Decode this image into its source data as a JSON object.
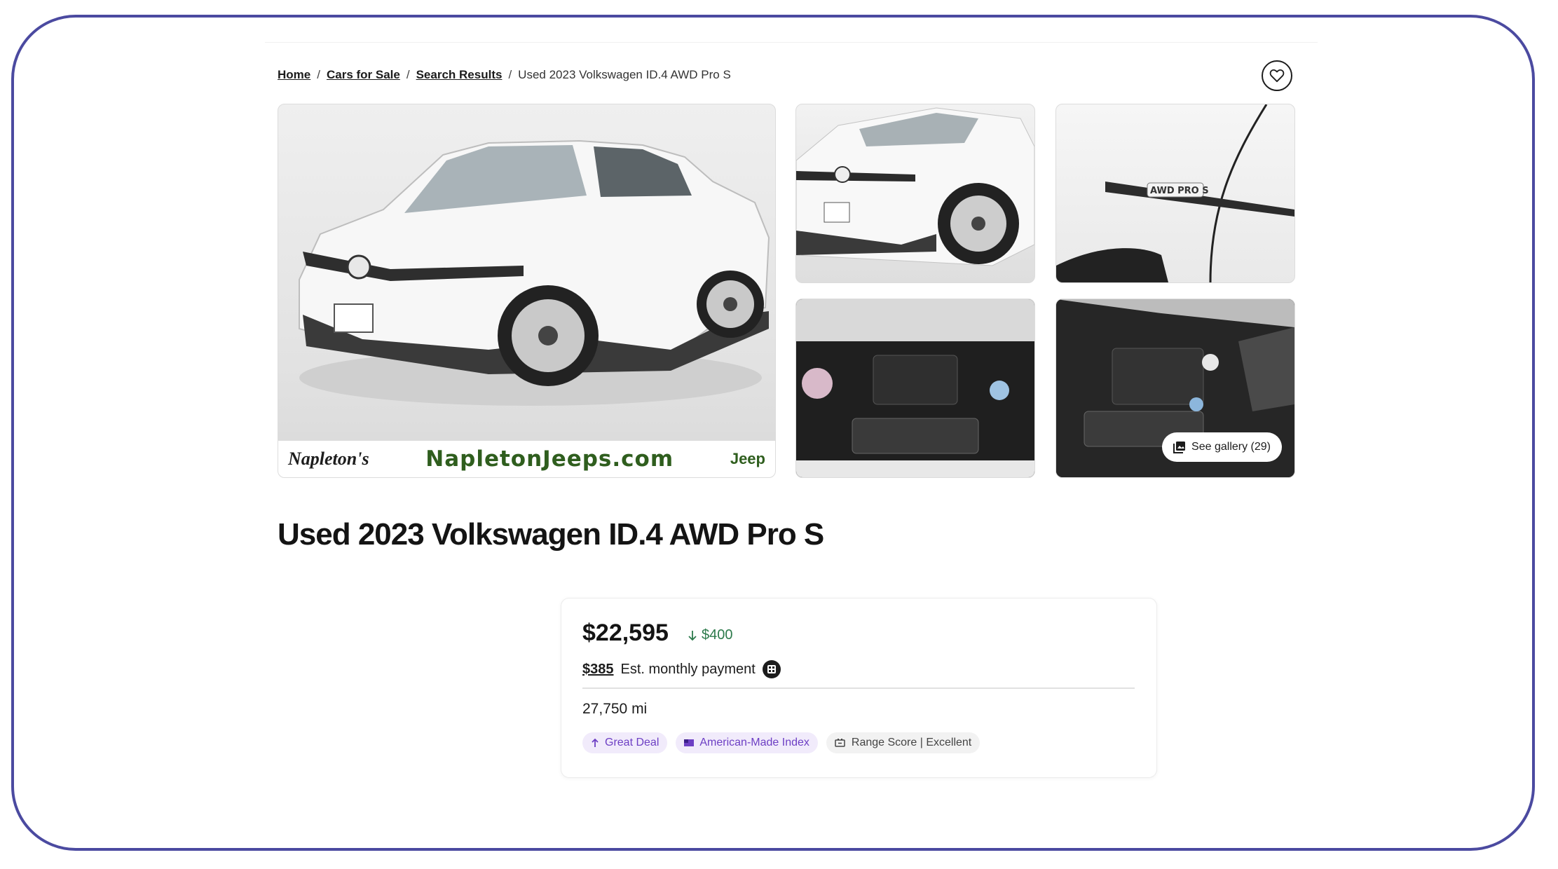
{
  "breadcrumb": {
    "items": [
      "Home",
      "Cars for Sale",
      "Search Results"
    ],
    "current": "Used 2023 Volkswagen ID.4 AWD Pro S",
    "separator": "/"
  },
  "favorite": {
    "icon": "heart-icon"
  },
  "gallery": {
    "dealer_logo": "Napleton's",
    "dealer_url": "NapletonJeeps.com",
    "dealer_brand": "Jeep",
    "thumb_badge": "AWD PRO S",
    "see_gallery_label": "See gallery (29)"
  },
  "listing": {
    "title": "Used 2023 Volkswagen ID.4 AWD Pro S"
  },
  "price_card": {
    "price": "$22,595",
    "price_drop": "$400",
    "monthly_amount": "$385",
    "monthly_label": "Est. monthly payment",
    "mileage": "27,750 mi",
    "badges": [
      "Great Deal",
      "American-Made Index",
      "Range Score | Excellent"
    ]
  },
  "colors": {
    "frame": "#4b4aa0",
    "deal_green": "#2c7a4b",
    "badge_purple": "#6d3fc4",
    "dealer_green": "#2f5e1e"
  }
}
